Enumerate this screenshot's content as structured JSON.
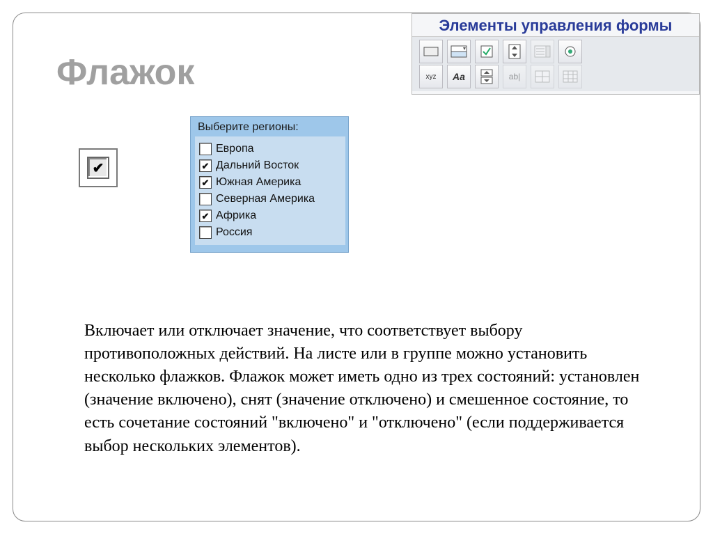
{
  "title": "Флажок",
  "toolbar": {
    "title": "Элементы управления формы",
    "row1": [
      {
        "name": "button-icon"
      },
      {
        "name": "combobox-icon"
      },
      {
        "name": "checkbox-icon"
      },
      {
        "name": "spinner-icon"
      },
      {
        "name": "listbox-icon"
      },
      {
        "name": "radio-icon"
      }
    ],
    "row2": [
      {
        "name": "label-icon",
        "text": "xyz"
      },
      {
        "name": "font-icon",
        "text": "Aa"
      },
      {
        "name": "updown-icon"
      },
      {
        "name": "editbox-icon",
        "text": "ab|"
      },
      {
        "name": "grid-icon"
      },
      {
        "name": "table-icon"
      }
    ]
  },
  "regions": {
    "title": "Выберите регионы:",
    "items": [
      {
        "label": "Европа",
        "checked": false
      },
      {
        "label": "Дальний Восток",
        "checked": true
      },
      {
        "label": "Южная Америка",
        "checked": true
      },
      {
        "label": "Северная Америка",
        "checked": false
      },
      {
        "label": "Африка",
        "checked": true
      },
      {
        "label": "Россия",
        "checked": false
      }
    ]
  },
  "paragraph": "Включает или отключает значение, что соответствует выбору противоположных действий. На листе или в группе можно установить несколько флажков. Флажок может иметь одно из трех состояний: установлен (значение включено), снят (значение отключено) и смешенное состояние, то есть сочетание состояний \"включено\" и \"отключено\" (если поддерживается выбор нескольких элементов)."
}
